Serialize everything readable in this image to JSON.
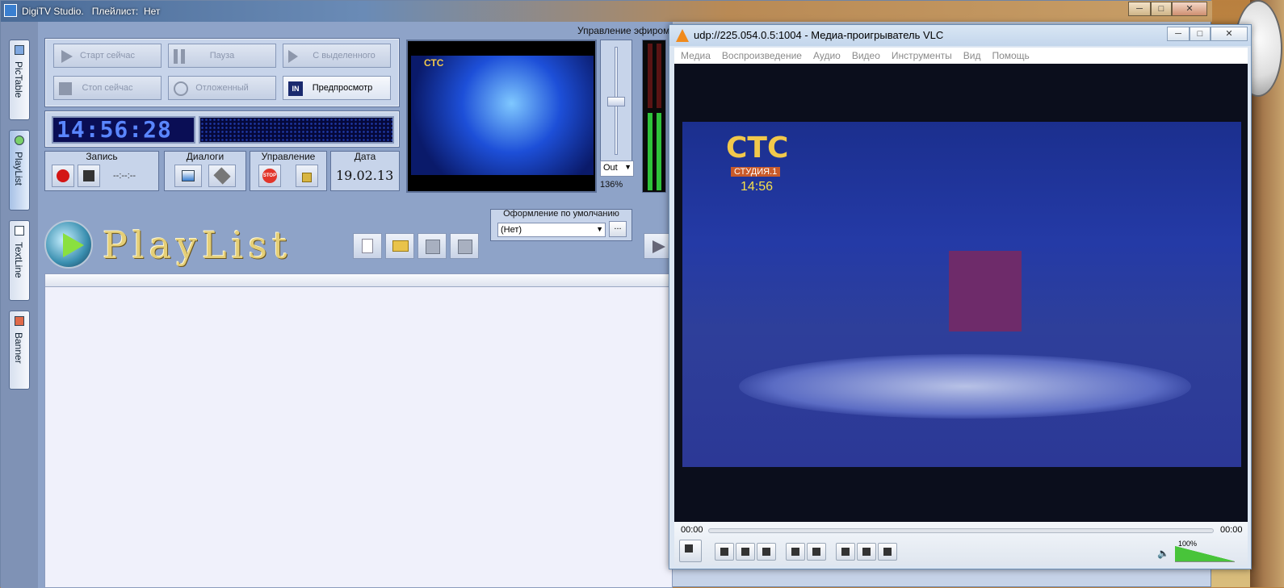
{
  "digitv": {
    "title": "DigiTV Studio.",
    "playlist_label": "Плейлист:",
    "playlist_value": "Нет",
    "side_tabs": [
      {
        "label": "PicTable"
      },
      {
        "label": "PlayList"
      },
      {
        "label": "TextLine"
      },
      {
        "label": "Banner"
      }
    ],
    "broadcast_label": "Управление эфиром",
    "buttons": {
      "start_now": "Старт сейчас",
      "pause": "Пауза",
      "from_selected": "С выделенного",
      "stop_now": "Стоп сейчас",
      "delayed": "Отложенный",
      "preview": "Предпросмотр"
    },
    "clock_display": "14:56:28",
    "groups": {
      "record": "Запись",
      "record_time": "--:--:--",
      "dialogs": "Диалоги",
      "control": "Управление",
      "stop_label": "STOP",
      "date_caption": "Дата",
      "date_value": "19.02.13"
    },
    "output_select": "Out",
    "volume_percent": "136%",
    "playlist_title": "PlayList",
    "design_caption": "Оформление по умолчанию",
    "design_select": "(Нет)",
    "design_more": "...",
    "preview_channel": "СТС"
  },
  "vlc": {
    "title": "udp://225.054.0.5:1004 - Медиа-проигрыватель VLC",
    "menu": [
      "Медиа",
      "Воспроизведение",
      "Аудио",
      "Видео",
      "Инструменты",
      "Вид",
      "Помощь"
    ],
    "overlay_channel": "СТС",
    "overlay_sub": "СТУДИЯ.1",
    "overlay_time": "14:56",
    "time_elapsed": "00:00",
    "time_total": "00:00",
    "volume": "100%"
  },
  "colors": {
    "led_blue": "#5a86ff",
    "vlc_volume": "#48c43a",
    "record_red": "#d31515"
  }
}
